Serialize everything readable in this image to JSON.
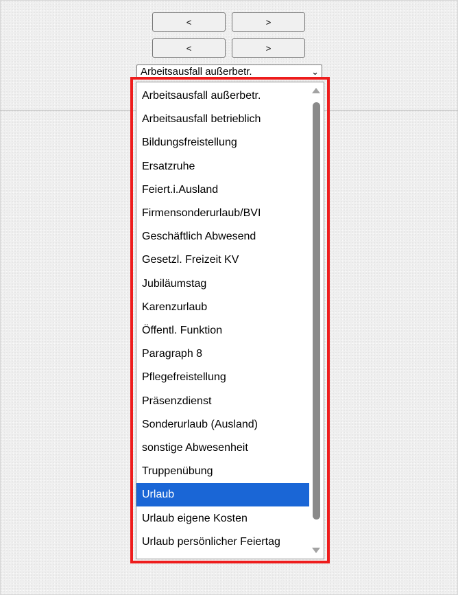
{
  "nav": {
    "row1": {
      "prev_label": "<",
      "next_label": ">"
    },
    "row2": {
      "prev_label": "<",
      "next_label": ">"
    }
  },
  "select": {
    "current_value": "Arbeitsausfall außerbetr.",
    "caret": "⌄"
  },
  "options": [
    "Arbeitsausfall außerbetr.",
    "Arbeitsausfall betrieblich",
    "Bildungsfreistellung",
    "Ersatzruhe",
    "Feiert.i.Ausland",
    "Firmensonderurlaub/BVI",
    "Geschäftlich Abwesend",
    "Gesetzl. Freizeit KV",
    "Jubiläumstag",
    "Karenzurlaub",
    "Öffentl. Funktion",
    "Paragraph 8",
    "Pflegefreistellung",
    "Präsenzdienst",
    "Sonderurlaub (Ausland)",
    "sonstige Abwesenheit",
    "Truppenübung",
    "Urlaub",
    "Urlaub eigene Kosten",
    "Urlaub persönlicher Feiertag"
  ],
  "selected_option": "Urlaub",
  "colors": {
    "highlight_border": "#ee1c1c",
    "selected_background": "#1a66d6"
  }
}
